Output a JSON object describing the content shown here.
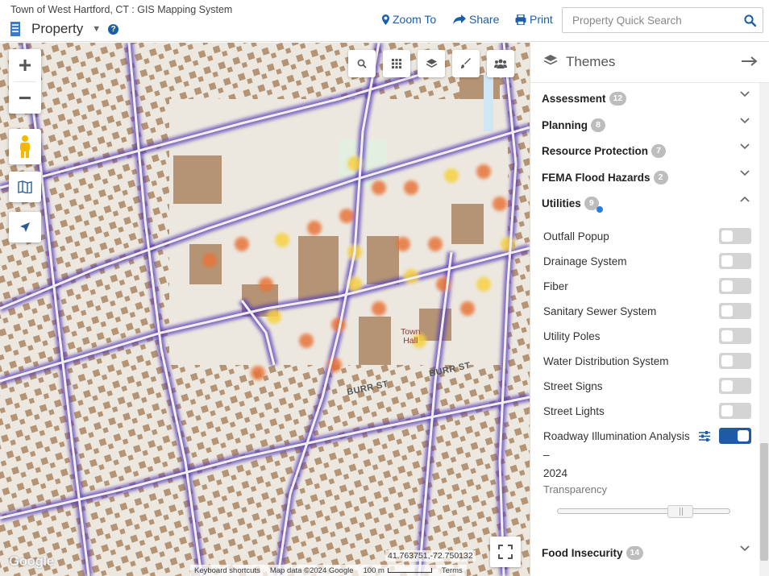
{
  "header": {
    "town_title": "Town of West Hartford, CT : GIS Mapping System",
    "mode_label": "Property",
    "zoom_to_label": "Zoom To",
    "share_label": "Share",
    "print_label": "Print",
    "search_placeholder": "Property Quick Search"
  },
  "map": {
    "labels": {
      "town_hall_line1": "Town",
      "town_hall_line2": "Hall",
      "burr_st_1": "BURR ST",
      "burr_st_2": "BURR ST"
    },
    "coordinates": "41.763751,-72.750132",
    "attribution": {
      "keyboard": "Keyboard shortcuts",
      "map_data": "Map data ©2024 Google",
      "scale": "100 m",
      "terms": "Terms"
    },
    "google_logo": "Google"
  },
  "themes": {
    "title": "Themes",
    "groups": [
      {
        "name": "Assessment",
        "count": "12"
      },
      {
        "name": "Planning",
        "count": "8"
      },
      {
        "name": "Resource Protection",
        "count": "7"
      },
      {
        "name": "FEMA Flood Hazards",
        "count": "2"
      },
      {
        "name": "Utilities",
        "count": "9"
      },
      {
        "name": "Food Insecurity",
        "count": "14"
      }
    ],
    "utilities_layers": [
      {
        "name": "Outfall Popup",
        "on": false
      },
      {
        "name": "Drainage System",
        "on": false
      },
      {
        "name": "Fiber",
        "on": false
      },
      {
        "name": "Sanitary Sewer System",
        "on": false
      },
      {
        "name": "Utility Poles",
        "on": false
      },
      {
        "name": "Water Distribution System",
        "on": false
      },
      {
        "name": "Street Signs",
        "on": false
      },
      {
        "name": "Street Lights",
        "on": false
      },
      {
        "name": "Roadway Illumination Analysis – 2024",
        "on": true
      }
    ],
    "roadway_line1": "Roadway Illumination Analysis –",
    "roadway_line2": "2024",
    "transparency_label": "Transparency",
    "transparency_value": 0.75
  },
  "colors": {
    "accent": "#1a5eaa",
    "toggle_on": "#1f5aa6",
    "badge": "#bdbdbd"
  }
}
